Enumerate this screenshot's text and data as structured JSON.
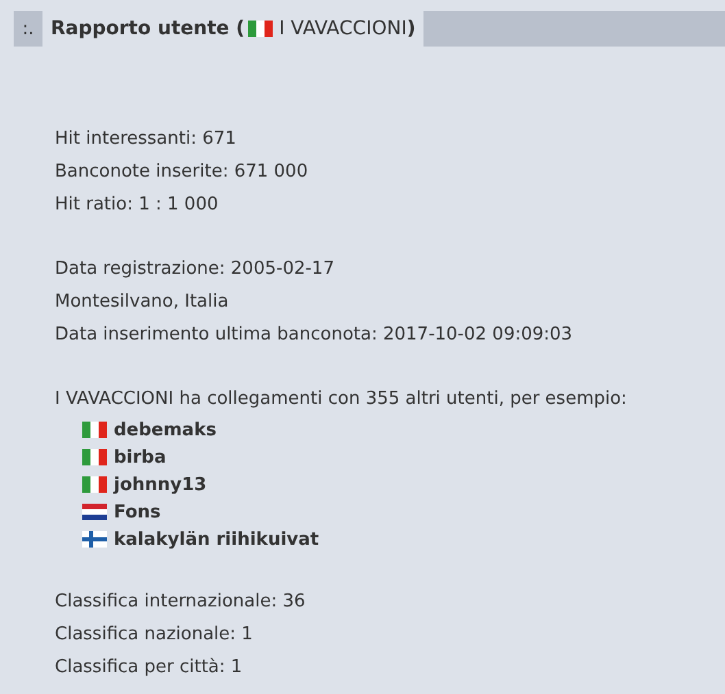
{
  "header": {
    "marker": ":.",
    "title": "Rapporto utente (",
    "kind": "it",
    "user": "I VAVACCIONI",
    "title_end": ")"
  },
  "groups": [
    [
      "Hit interessanti: 671",
      "Banconote inserite: 671 000",
      "Hit ratio: 1 : 1 000"
    ],
    [
      "Data registrazione: 2005-02-17",
      "Montesilvano, Italia",
      "Data inserimento ultima banconota: 2017-10-02 09:09:03"
    ]
  ],
  "connections": {
    "intro": "I VAVACCIONI ha collegamenti con 355 altri utenti, per esempio:",
    "users": [
      {
        "name": "debemaks",
        "kind": "it"
      },
      {
        "name": "birba",
        "kind": "it"
      },
      {
        "name": "johnny13",
        "kind": "it"
      },
      {
        "name": "Fons",
        "kind": "nl"
      },
      {
        "name": "kalakylän riihikuivat",
        "kind": "fi"
      }
    ]
  },
  "rankings": [
    "Classifica internazionale: 36",
    "Classifica nazionale: 1",
    "Classifica per città: 1"
  ]
}
